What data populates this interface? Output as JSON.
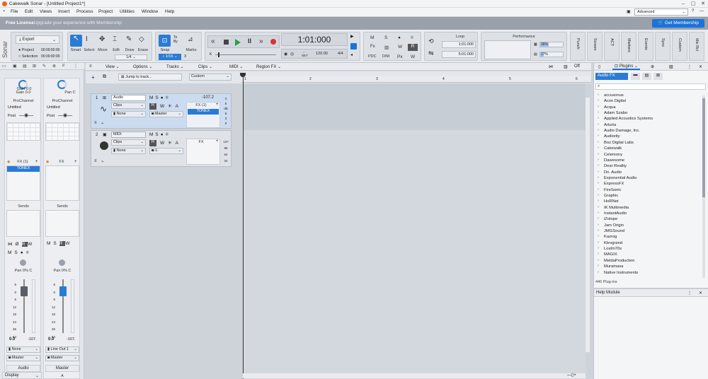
{
  "app": {
    "title": "Cakewalk Sonar - [Untitled Project1*]",
    "workspace": "Advanced",
    "brand": "Sonar"
  },
  "menu": [
    "File",
    "Edit",
    "Views",
    "Insert",
    "Process",
    "Project",
    "Utilities",
    "Window",
    "Help"
  ],
  "license": {
    "label": "Free License:",
    "message": "Upgrade your experience with Membership",
    "button": "Get Membership"
  },
  "control": {
    "export": "Export",
    "project": "Project",
    "selection": "Selection",
    "project_time": "00:00:00:00",
    "selection_time": "00:00:00:00",
    "tools": [
      "Smart",
      "Select",
      "Move",
      "Edit",
      "Draw",
      "Erase"
    ],
    "tool_fraction": "1/4",
    "snap": "Snap",
    "snap_value": "1/16",
    "snap_count": "3",
    "marks": "Marks",
    "time": "1:01:000",
    "tempo": "120.00",
    "signature": "4/4",
    "set": "SET",
    "loop": "Loop",
    "loop_start": "1:01:000",
    "loop_end": "5:01:000",
    "performance": "Performance",
    "cpu": "36%",
    "disk": "17%",
    "rack": [
      "Punch",
      "Screen",
      "ACT",
      "Markers",
      "Events",
      "Sync",
      "Custom",
      "Mix Rcl"
    ]
  },
  "inspector": {
    "strip1": {
      "gain": "Gain 0.0",
      "gain2": "Gain 0.0",
      "pan2": "Pan C",
      "prochannel": "ProChannel",
      "preset": "Untitled",
      "post": "Post",
      "fx": "FX (1)",
      "plugin": "TONEX",
      "sends": "Sends",
      "pan": "Pan 0% C",
      "vol": "0.0",
      "peak": "-107.",
      "input": "None",
      "output": "Master",
      "name": "Audio",
      "num": "1"
    },
    "strip2": {
      "prochannel": "ProChannel",
      "preset": "Untitled",
      "post": "Post",
      "fx": "FX",
      "sends": "Sends",
      "pan": "Pan 0% C",
      "vol": "0.0",
      "peak": "-107.",
      "input": "Line Out 1",
      "output": "Master",
      "name": "Master",
      "num": "A"
    },
    "display": "Display",
    "fader_scale": [
      "6",
      "0",
      "6",
      "12",
      "18",
      "24",
      "36",
      "54"
    ]
  },
  "trackview": {
    "menus": [
      "View",
      "Options",
      "Tracks",
      "Clips",
      "MIDI",
      "Region FX"
    ],
    "jump": "Jump to track...",
    "custom": "Custom",
    "off": "Off",
    "ruler": [
      "1",
      "2",
      "3",
      "4",
      "5",
      "6"
    ],
    "tracks": [
      {
        "num": "1",
        "name": "Audio",
        "clips": "Clips",
        "input": "None",
        "output": "Master",
        "vol": "-107.2",
        "fx": "FX (1)",
        "plugin": "TONEX",
        "scale": [
          "3",
          "6",
          "dB",
          "6",
          "3",
          "0"
        ]
      },
      {
        "num": "2",
        "name": "MIDI",
        "clips": "Clips",
        "input": "None",
        "output": "1-",
        "fx": "FX",
        "scale": [
          "127",
          "96",
          "64",
          "32"
        ]
      }
    ]
  },
  "browser": {
    "tab": "Plugins",
    "category": "Audio FX",
    "count": "446 Plug-ins",
    "help": "Help Module",
    "vendors": [
      "accusonus",
      "Acon Digital",
      "Acqua",
      "Adam Szabo",
      "Applied Acoustics Systems",
      "Arturia",
      "Audio Damage, Inc.",
      "Audiority",
      "Boz Digital Labs",
      "Cakewalk",
      "Celemony",
      "Dawesome",
      "Dear Reality",
      "Dn. Audio",
      "Exponential Audio",
      "ExpressFX",
      "FireSonic",
      "Graphic",
      "HoRNet",
      "IK Multimedia",
      "InstantAudio",
      "iZotope",
      "Jam Origin",
      "JMGSound",
      "Kazrog",
      "Klevgrand",
      "LostIn70s",
      "MAGIX",
      "MeldaProduction",
      "Muramasa",
      "Native Instruments"
    ]
  },
  "colors": {
    "accent": "#1a73d9",
    "play": "#27a243",
    "record": "#d93434",
    "selected": "#2a7bd6"
  }
}
